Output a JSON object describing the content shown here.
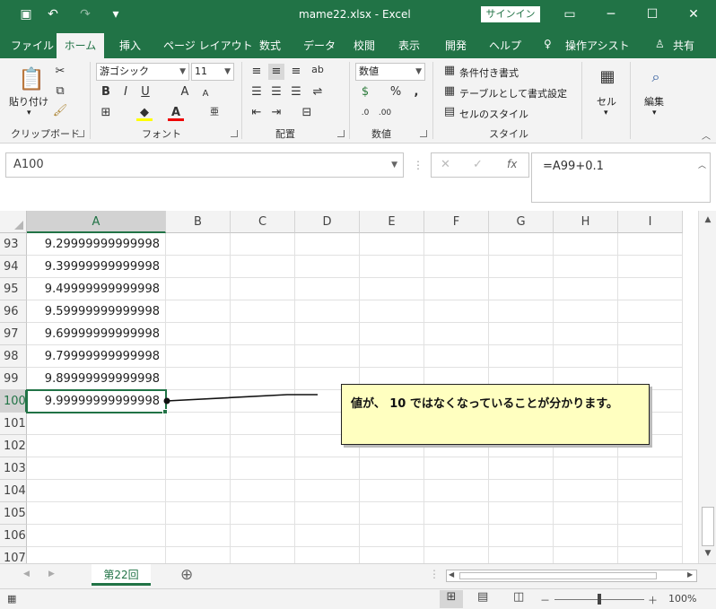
{
  "window": {
    "title": "mame22.xlsx  -  Excel",
    "signin": "サインイン",
    "qa_undo": "↶",
    "qa_redo": "↷",
    "qa_more": "▾",
    "minimize": "─",
    "restore": "☐",
    "close": "✕",
    "ribbon_options": "▭"
  },
  "tabs": [
    {
      "label": "ファイル"
    },
    {
      "label": "ホーム"
    },
    {
      "label": "挿入"
    },
    {
      "label": "ページ レイアウト"
    },
    {
      "label": "数式"
    },
    {
      "label": "データ"
    },
    {
      "label": "校閲"
    },
    {
      "label": "表示"
    },
    {
      "label": "開発"
    },
    {
      "label": "ヘルプ"
    },
    {
      "label": "操作アシスト"
    },
    {
      "label": "共有"
    }
  ],
  "ribbon": {
    "paste_label": "貼り付け",
    "clipboard_label": "クリップボード",
    "font_name": "游ゴシック",
    "font_size": "11",
    "font_label": "フォント",
    "bold": "B",
    "italic": "I",
    "underline": "U",
    "align_label": "配置",
    "number_format": "数値",
    "number_label": "数値",
    "percent": "%",
    "cond_format": "条件付き書式",
    "table_format": "テーブルとして書式設定",
    "cell_style": "セルのスタイル",
    "style_label": "スタイル",
    "cells_label": "セル",
    "edit_label": "編集"
  },
  "formula_bar": {
    "name_box": "A100",
    "formula": "=A99+0.1",
    "cancel": "✕",
    "enter": "✓",
    "fx": "fx"
  },
  "grid": {
    "columns": [
      "A",
      "B",
      "C",
      "D",
      "E",
      "F",
      "G",
      "H",
      "I"
    ],
    "rows": [
      {
        "num": "93",
        "a": "9.29999999999998"
      },
      {
        "num": "94",
        "a": "9.39999999999998"
      },
      {
        "num": "95",
        "a": "9.49999999999998"
      },
      {
        "num": "96",
        "a": "9.59999999999998"
      },
      {
        "num": "97",
        "a": "9.69999999999998"
      },
      {
        "num": "98",
        "a": "9.79999999999998"
      },
      {
        "num": "99",
        "a": "9.89999999999998"
      },
      {
        "num": "100",
        "a": "9.99999999999998"
      },
      {
        "num": "101",
        "a": ""
      },
      {
        "num": "102",
        "a": ""
      },
      {
        "num": "103",
        "a": ""
      },
      {
        "num": "104",
        "a": ""
      },
      {
        "num": "105",
        "a": ""
      },
      {
        "num": "106",
        "a": ""
      },
      {
        "num": "107",
        "a": ""
      }
    ]
  },
  "callout": {
    "text": "値が、 10 ではなくなっていることが分かります。"
  },
  "sheet": {
    "tab": "第22回",
    "add": "⊕"
  },
  "status": {
    "zoom": "100%",
    "zoom_minus": "－",
    "zoom_plus": "＋"
  }
}
